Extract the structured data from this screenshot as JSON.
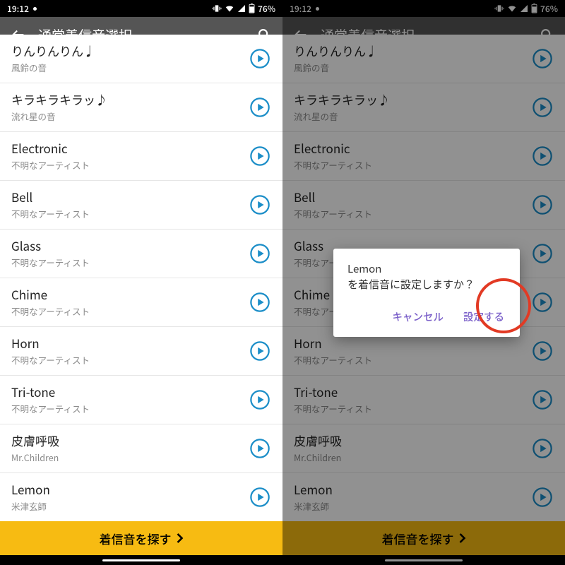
{
  "status": {
    "time": "19:12",
    "battery": "76%",
    "icons": [
      "vibrate-icon",
      "wifi-icon",
      "signal-icon",
      "battery-icon"
    ]
  },
  "appbar": {
    "title": "通常着信音選択"
  },
  "ringtones": [
    {
      "title": "りんりんりん♩",
      "sub": "風鈴の音"
    },
    {
      "title": "キラキラキラッ♪",
      "sub": "流れ星の音"
    },
    {
      "title": "Electronic",
      "sub": "不明なアーティスト"
    },
    {
      "title": "Bell",
      "sub": "不明なアーティスト"
    },
    {
      "title": "Glass",
      "sub": "不明なアーティスト"
    },
    {
      "title": "Chime",
      "sub": "不明なアーティスト"
    },
    {
      "title": "Horn",
      "sub": "不明なアーティスト"
    },
    {
      "title": "Tri-tone",
      "sub": "不明なアーティスト"
    },
    {
      "title": "皮膚呼吸",
      "sub": "Mr.Children"
    },
    {
      "title": "Lemon",
      "sub": "米津玄師"
    }
  ],
  "footer": {
    "label": "着信音を探す"
  },
  "dialog": {
    "line1": "Lemon",
    "line2": "を着信音に設定しますか？",
    "cancel": "キャンセル",
    "confirm": "設定する"
  }
}
